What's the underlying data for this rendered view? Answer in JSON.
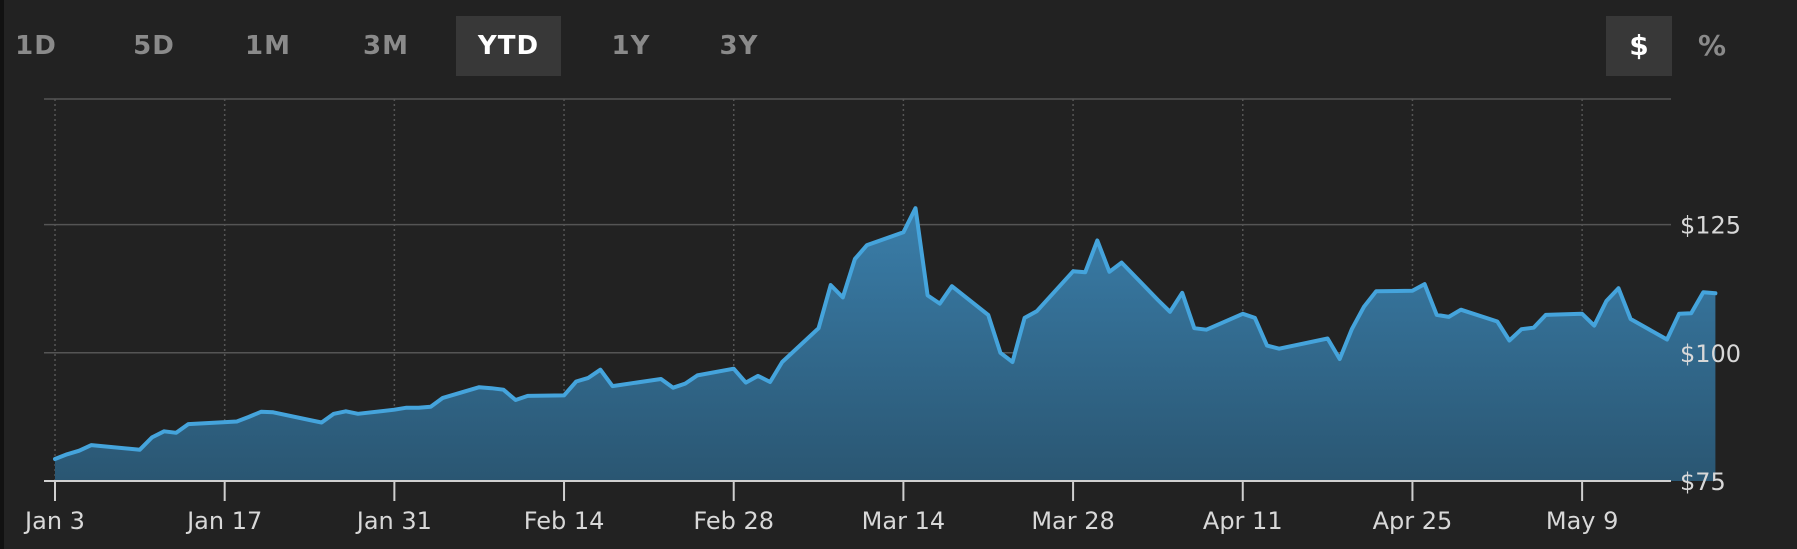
{
  "range_selector": {
    "options": [
      "1D",
      "5D",
      "1M",
      "3M",
      "YTD",
      "1Y",
      "3Y"
    ],
    "selected": "YTD"
  },
  "mode_toggle": {
    "options": [
      "$",
      "%"
    ],
    "selected": "$"
  },
  "colors": {
    "background": "#222222",
    "line": "#45a4dc",
    "fill_top": "#3a7eaa",
    "fill_bottom": "#2a5672",
    "grid_h": "#555555",
    "grid_v": "#555555",
    "text": "#d8d8d8"
  },
  "chart_data": {
    "type": "area",
    "title": "",
    "xlabel": "",
    "ylabel": "",
    "x_ticks": [
      "Jan 3",
      "Jan 17",
      "Jan 31",
      "Feb 14",
      "Feb 28",
      "Mar 14",
      "Mar 28",
      "Apr 11",
      "Apr 25",
      "May 9"
    ],
    "y_ticks": [
      "$75",
      "$100",
      "$125"
    ],
    "ylim": [
      75,
      149.5
    ],
    "grid": true,
    "series": [
      {
        "values": [
          [
            "2022-01-03",
            79.3
          ],
          [
            "2022-01-04",
            80.2
          ],
          [
            "2022-01-05",
            80.9
          ],
          [
            "2022-01-06",
            82.0
          ],
          [
            "2022-01-10",
            81.1
          ],
          [
            "2022-01-11",
            83.5
          ],
          [
            "2022-01-12",
            84.7
          ],
          [
            "2022-01-13",
            84.4
          ],
          [
            "2022-01-14",
            86.1
          ],
          [
            "2022-01-18",
            86.6
          ],
          [
            "2022-01-19",
            87.5
          ],
          [
            "2022-01-20",
            88.5
          ],
          [
            "2022-01-21",
            88.4
          ],
          [
            "2022-01-24",
            86.9
          ],
          [
            "2022-01-25",
            86.4
          ],
          [
            "2022-01-26",
            88.1
          ],
          [
            "2022-01-27",
            88.6
          ],
          [
            "2022-01-28",
            88.1
          ],
          [
            "2022-01-31",
            88.9
          ],
          [
            "2022-02-01",
            89.3
          ],
          [
            "2022-02-02",
            89.3
          ],
          [
            "2022-02-03",
            89.5
          ],
          [
            "2022-02-04",
            91.2
          ],
          [
            "2022-02-07",
            93.3
          ],
          [
            "2022-02-08",
            93.1
          ],
          [
            "2022-02-09",
            92.8
          ],
          [
            "2022-02-10",
            90.8
          ],
          [
            "2022-02-11",
            91.6
          ],
          [
            "2022-02-14",
            91.7
          ],
          [
            "2022-02-15",
            94.4
          ],
          [
            "2022-02-16",
            95.1
          ],
          [
            "2022-02-17",
            96.7
          ],
          [
            "2022-02-18",
            93.5
          ],
          [
            "2022-02-22",
            94.9
          ],
          [
            "2022-02-23",
            93.2
          ],
          [
            "2022-02-24",
            94.0
          ],
          [
            "2022-02-25",
            95.6
          ],
          [
            "2022-02-28",
            96.9
          ],
          [
            "2022-03-01",
            94.2
          ],
          [
            "2022-03-02",
            95.5
          ],
          [
            "2022-03-03",
            94.3
          ],
          [
            "2022-03-04",
            98.2
          ],
          [
            "2022-03-07",
            104.8
          ],
          [
            "2022-03-08",
            113.2
          ],
          [
            "2022-03-09",
            110.8
          ],
          [
            "2022-03-10",
            118.3
          ],
          [
            "2022-03-11",
            121.0
          ],
          [
            "2022-03-14",
            123.5
          ],
          [
            "2022-03-15",
            128.2
          ],
          [
            "2022-03-16",
            111.2
          ],
          [
            "2022-03-17",
            109.6
          ],
          [
            "2022-03-18",
            113.0
          ],
          [
            "2022-03-21",
            107.4
          ],
          [
            "2022-03-22",
            100.0
          ],
          [
            "2022-03-23",
            98.2
          ],
          [
            "2022-03-24",
            106.8
          ],
          [
            "2022-03-25",
            108.1
          ],
          [
            "2022-03-28",
            115.9
          ],
          [
            "2022-03-29",
            115.7
          ],
          [
            "2022-03-30",
            121.9
          ],
          [
            "2022-03-31",
            115.8
          ],
          [
            "2022-04-01",
            117.6
          ],
          [
            "2022-04-04",
            110.3
          ],
          [
            "2022-04-05",
            108.0
          ],
          [
            "2022-04-06",
            111.7
          ],
          [
            "2022-04-07",
            104.8
          ],
          [
            "2022-04-08",
            104.5
          ],
          [
            "2022-04-11",
            107.6
          ],
          [
            "2022-04-12",
            106.8
          ],
          [
            "2022-04-13",
            101.4
          ],
          [
            "2022-04-14",
            100.8
          ],
          [
            "2022-04-18",
            102.8
          ],
          [
            "2022-04-19",
            98.8
          ],
          [
            "2022-04-20",
            104.6
          ],
          [
            "2022-04-21",
            109.0
          ],
          [
            "2022-04-22",
            112.0
          ],
          [
            "2022-04-25",
            112.1
          ],
          [
            "2022-04-26",
            113.4
          ],
          [
            "2022-04-27",
            107.4
          ],
          [
            "2022-04-28",
            107.0
          ],
          [
            "2022-04-29",
            108.4
          ],
          [
            "2022-05-02",
            106.1
          ],
          [
            "2022-05-03",
            102.4
          ],
          [
            "2022-05-04",
            104.6
          ],
          [
            "2022-05-05",
            104.9
          ],
          [
            "2022-05-06",
            107.4
          ],
          [
            "2022-05-09",
            107.6
          ],
          [
            "2022-05-10",
            105.3
          ],
          [
            "2022-05-11",
            110.1
          ],
          [
            "2022-05-12",
            112.6
          ],
          [
            "2022-05-13",
            106.6
          ],
          [
            "2022-05-16",
            102.6
          ],
          [
            "2022-05-17",
            107.6
          ],
          [
            "2022-05-18",
            107.7
          ],
          [
            "2022-05-19",
            111.8
          ],
          [
            "2022-05-20",
            111.6
          ]
        ]
      }
    ]
  }
}
